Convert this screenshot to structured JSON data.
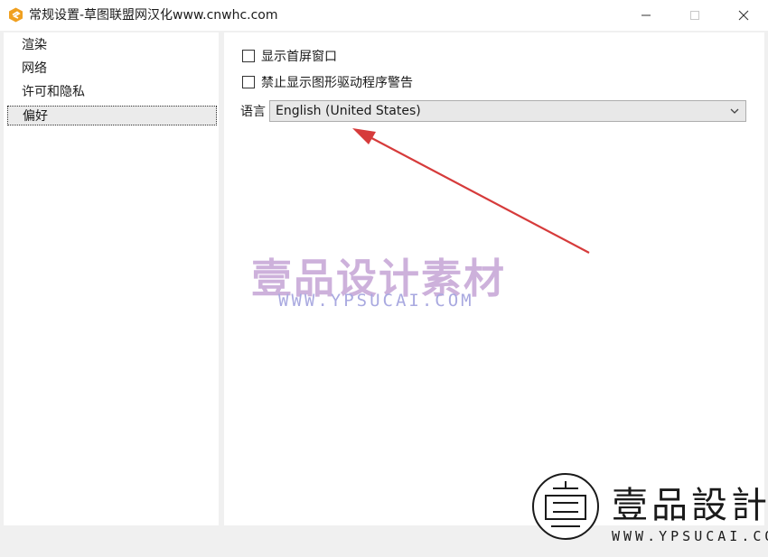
{
  "window": {
    "title": "常规设置-草图联盟网汉化www.cnwhc.com",
    "app_icon": "sketchup-logo-icon",
    "controls": [
      "minimize-icon",
      "maximize-icon",
      "close-icon"
    ]
  },
  "sidebar": {
    "items": [
      {
        "label": "渲染",
        "selected": false
      },
      {
        "label": "网络",
        "selected": false
      },
      {
        "label": "许可和隐私",
        "selected": false
      },
      {
        "label": "偏好",
        "selected": true
      }
    ]
  },
  "preferences": {
    "show_welcome_window": {
      "label": "显示首屏窗口",
      "checked": false
    },
    "disable_driver_warning": {
      "label": "禁止显示图形驱动程序警告",
      "checked": false
    },
    "language": {
      "label": "语言",
      "value": "English (United States)"
    }
  },
  "annotation": {
    "color": "#d63b3b"
  },
  "watermarks": {
    "center": {
      "text": "壹品设计素材",
      "url": "WWW.YPSUCAI.COM"
    },
    "corner": {
      "text": "壹品設計",
      "url": "WWW.YPSUCAI.COM"
    }
  },
  "colors": {
    "accent": "#f0a020",
    "arrow": "#d63b3b"
  }
}
